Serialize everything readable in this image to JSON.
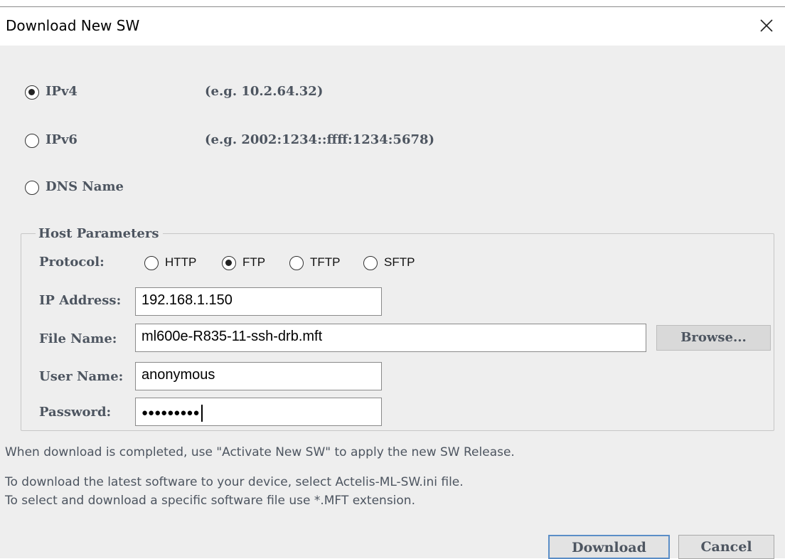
{
  "window": {
    "title": "Download New SW",
    "close_icon": "close-icon"
  },
  "address_type": {
    "options": [
      {
        "label": "IPv4",
        "example": "(e.g. 10.2.64.32)",
        "selected": true
      },
      {
        "label": "IPv6",
        "example": "(e.g. 2002:1234::ffff:1234:5678)",
        "selected": false
      },
      {
        "label": "DNS Name",
        "example": "",
        "selected": false
      }
    ]
  },
  "host_parameters": {
    "legend": "Host Parameters",
    "protocol_label": "Protocol:",
    "protocols": [
      {
        "label": "HTTP",
        "selected": false
      },
      {
        "label": "FTP",
        "selected": true
      },
      {
        "label": "TFTP",
        "selected": false
      },
      {
        "label": "SFTP",
        "selected": false
      }
    ],
    "ip_label": "IP Address:",
    "ip_value": "192.168.1.150",
    "file_label": "File Name:",
    "file_value": "ml600e-R835-11-ssh-drb.mft",
    "browse_label": "Browse...",
    "user_label": "User Name:",
    "user_value": "anonymous",
    "password_label": "Password:",
    "password_value": "●●●●●●●●●"
  },
  "info": {
    "line1": "When download is completed, use \"Activate New SW\" to apply the new SW Release.",
    "line2": "To download the latest software to your device, select Actelis-ML-SW.ini file.",
    "line3": "To select and download a specific software file use *.MFT extension."
  },
  "buttons": {
    "download": "Download",
    "cancel": "Cancel"
  },
  "colors": {
    "accent_border": "#5b8ec7",
    "label_color": "#4d5560"
  }
}
